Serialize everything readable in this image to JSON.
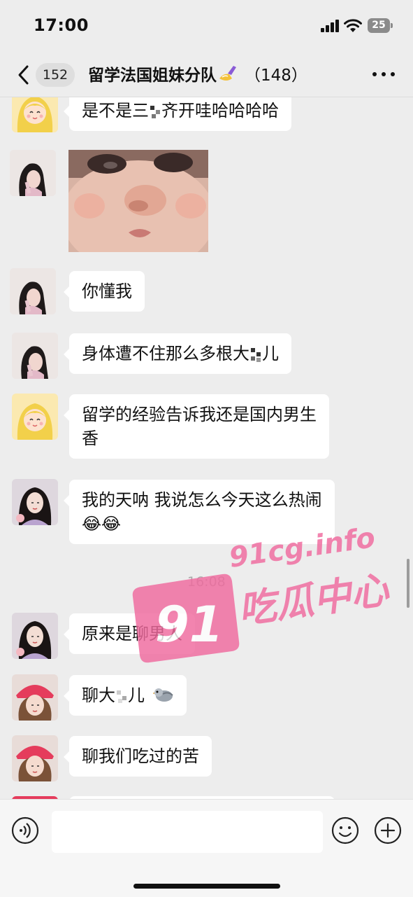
{
  "status_bar": {
    "time": "17:00",
    "battery": "25"
  },
  "header": {
    "unread_count": "152",
    "group_name": "留学法国姐妹分队",
    "member_count": "（148）"
  },
  "messages": [
    {
      "text_before": "是不是三",
      "text_after": "齐开哇哈哈哈哈"
    },
    {
      "type": "sticker"
    },
    {
      "text": "你懂我"
    },
    {
      "text_before": "身体遭不住那么多根大",
      "text_after": "儿"
    },
    {
      "line1": "留学的经验告诉我还是国内男生",
      "line2": "香"
    },
    {
      "line1": "我的天呐 我说怎么今天这么热闹",
      "line2": "😂😂"
    },
    {
      "text": "原来是聊男人"
    },
    {
      "text_before": "聊大",
      "text_after": "儿"
    },
    {
      "text": "聊我们吃过的苦"
    }
  ],
  "timestamp": "16:08",
  "watermark": {
    "site": "91cg.info",
    "name": "吃瓜中心",
    "logo": "91"
  },
  "icons": {
    "back": "chevron-left-icon",
    "more": "more-icon",
    "voice": "voice-icon",
    "emoji": "smiley-icon",
    "plus": "plus-icon",
    "pigeon": "pigeon-icon"
  }
}
